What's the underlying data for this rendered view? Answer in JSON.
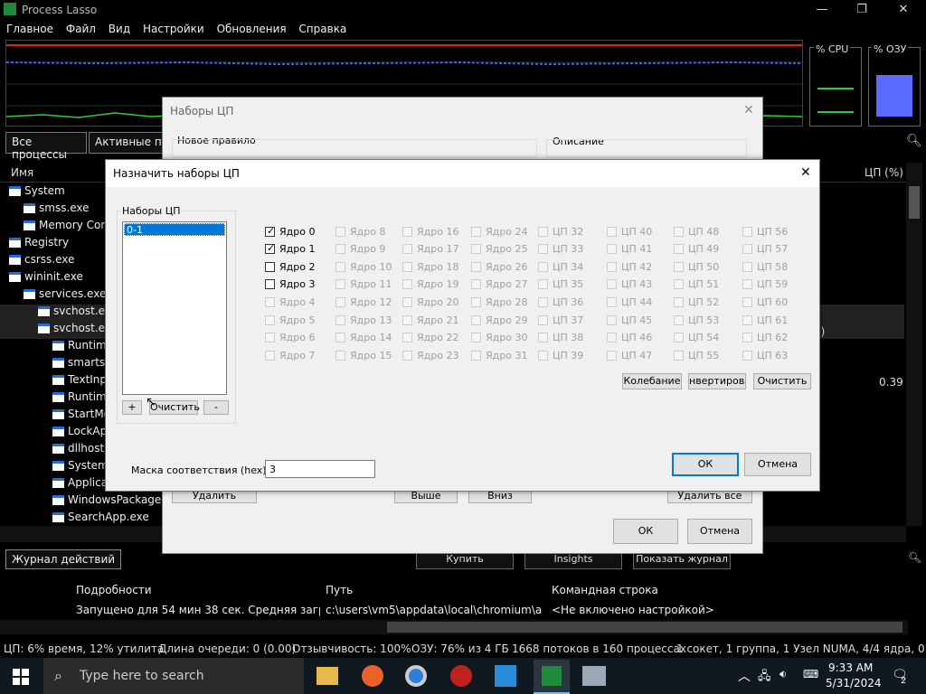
{
  "app": {
    "title": "Process Lasso",
    "win_min": "—",
    "win_max": "❐",
    "win_close": "✕"
  },
  "menu": [
    "Главное",
    "Файл",
    "Вид",
    "Настройки",
    "Обновления",
    "Справка"
  ],
  "meters": {
    "cpu_label": "% CPU",
    "ram_label": "% ОЗУ"
  },
  "tabs": {
    "all": "Все процессы",
    "active": "Активные про"
  },
  "columns": {
    "name": "Имя",
    "cpu": "ЦП (%)"
  },
  "processes": [
    {
      "name": "System",
      "indent": 0
    },
    {
      "name": "smss.exe",
      "indent": 1
    },
    {
      "name": "Memory Comp",
      "indent": 1
    },
    {
      "name": "Registry",
      "indent": 0
    },
    {
      "name": "csrss.exe",
      "indent": 0
    },
    {
      "name": "wininit.exe",
      "indent": 0
    },
    {
      "name": "services.exe",
      "indent": 1
    },
    {
      "name": "svchost.exe",
      "indent": 2
    },
    {
      "name": "svchost.exe",
      "indent": 2
    },
    {
      "name": "Runtim",
      "indent": 3
    },
    {
      "name": "smartsc",
      "indent": 3
    },
    {
      "name": "TextInp",
      "indent": 3
    },
    {
      "name": "Runtim",
      "indent": 3
    },
    {
      "name": "StartMe",
      "indent": 3
    },
    {
      "name": "LockAp",
      "indent": 3
    },
    {
      "name": "dllhost.",
      "indent": 3
    },
    {
      "name": "System",
      "indent": 3
    },
    {
      "name": "Applica",
      "indent": 3
    },
    {
      "name": "WindowsPackageM",
      "indent": 3
    },
    {
      "name": "SearchApp.exe",
      "indent": 3
    }
  ],
  "cpu_value": "0.39",
  "row_fragment": "3)",
  "log": {
    "tab": "Журнал действий",
    "buy": "Купить",
    "insights": "Insights",
    "show_log": "Показать журнал",
    "headers": [
      "Подробности",
      "Путь",
      "Командная строка"
    ],
    "row": [
      "Запущено для 54 мин 38 сек. Средняя загрузк...",
      "c:\\users\\vm5\\appdata\\local\\chromium\\ap...",
      "<Не включено настройкой>"
    ]
  },
  "status": {
    "cpu": "ЦП: 6% время, 12% утилита",
    "queue": "Длина очереди: 0 (0.00)",
    "resp": "Отзывчивость: 100%",
    "ram": "ОЗУ: 76% из 4 ГБ",
    "threads": "1668 потоков в 160 процессах",
    "topo": "1 сокет, 1 группа, 1 Узел NUMA, 4/4 ядра, 0 припа"
  },
  "taskbar": {
    "search_placeholder": "Type here to search",
    "time": "9:33 AM",
    "date": "5/31/2024",
    "notif_count": "2"
  },
  "dlg1": {
    "title": "Наборы ЦП",
    "new_rule": "Новое правило",
    "description": "Описание",
    "delete": "Удалить",
    "up": "Выше",
    "down": "Вниз",
    "delete_all": "Удалить все",
    "ok": "ОК",
    "cancel": "Отмена"
  },
  "dlg2": {
    "title": "Назначить наборы ЦП",
    "group_label": "Наборы ЦП",
    "list_items": [
      "0-1"
    ],
    "add": "+",
    "clear_small": "Очистить",
    "remove": "-",
    "wobble": "Колебание",
    "invert": "нвертирова",
    "clear": "Очистить",
    "mask_label": "Маска соответствия (hex):",
    "mask_value": "3",
    "ok": "ОК",
    "cancel": "Отмена",
    "cores": [
      [
        "Ядро 0",
        "Ядро 1",
        "Ядро 2",
        "Ядро 3",
        "Ядро 4",
        "Ядро 5",
        "Ядро 6",
        "Ядро 7"
      ],
      [
        "Ядро 8",
        "Ядро 9",
        "Ядро 10",
        "Ядро 11",
        "Ядро 12",
        "Ядро 13",
        "Ядро 14",
        "Ядро 15"
      ],
      [
        "Ядро 16",
        "Ядро 17",
        "Ядро 18",
        "Ядро 19",
        "Ядро 20",
        "Ядро 21",
        "Ядро 22",
        "Ядро 23"
      ],
      [
        "Ядро 24",
        "Ядро 25",
        "Ядро 26",
        "Ядро 27",
        "Ядро 28",
        "Ядро 29",
        "Ядро 30",
        "Ядро 31"
      ],
      [
        "ЦП 32",
        "ЦП 33",
        "ЦП 34",
        "ЦП 35",
        "ЦП 36",
        "ЦП 37",
        "ЦП 38",
        "ЦП 39"
      ],
      [
        "ЦП 40",
        "ЦП 41",
        "ЦП 42",
        "ЦП 43",
        "ЦП 44",
        "ЦП 45",
        "ЦП 46",
        "ЦП 47"
      ],
      [
        "ЦП 48",
        "ЦП 49",
        "ЦП 50",
        "ЦП 51",
        "ЦП 52",
        "ЦП 53",
        "ЦП 54",
        "ЦП 55"
      ],
      [
        "ЦП 56",
        "ЦП 57",
        "ЦП 58",
        "ЦП 59",
        "ЦП 60",
        "ЦП 61",
        "ЦП 62",
        "ЦП 63"
      ]
    ],
    "checked": [
      "Ядро 0",
      "Ядро 1"
    ],
    "enabled": [
      "Ядро 0",
      "Ядро 1",
      "Ядро 2",
      "Ядро 3"
    ]
  },
  "colors": {
    "accent": "#0078d7",
    "graph_green": "#2ecc40",
    "graph_red": "#e02020",
    "graph_blue": "#4b5cff",
    "ram_fill": "#5a6cff"
  }
}
